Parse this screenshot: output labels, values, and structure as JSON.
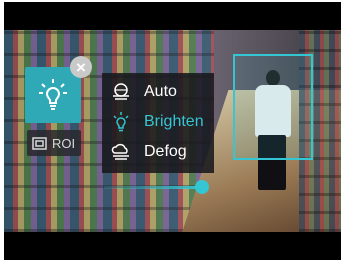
{
  "overlay": {
    "close_glyph": "×",
    "roi_label": "ROI"
  },
  "menu": {
    "items": [
      {
        "label": "Auto",
        "icon": "auto-exposure-icon",
        "active": false
      },
      {
        "label": "Brighten",
        "icon": "bulb-outline-icon",
        "active": true
      },
      {
        "label": "Defog",
        "icon": "cloud-fog-icon",
        "active": false
      }
    ]
  },
  "slider": {
    "value": 0.98
  },
  "colors": {
    "accent": "#35c6d3",
    "menu_bg": "#19191e"
  }
}
